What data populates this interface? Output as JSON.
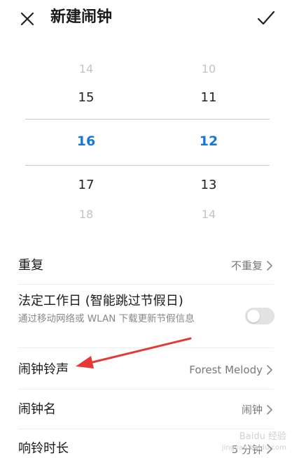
{
  "header": {
    "title": "新建闹钟"
  },
  "time_picker": {
    "hour": {
      "above_far": "14",
      "above": "15",
      "selected": "16",
      "below": "17",
      "below_far": "18"
    },
    "minute": {
      "above_far": "10",
      "above": "11",
      "selected": "12",
      "below": "13",
      "below_far": "14"
    },
    "accent_color": "#1878d6"
  },
  "settings": {
    "repeat": {
      "label": "重复",
      "value": "不重复"
    },
    "workday": {
      "label": "法定工作日 (智能跳过节假日)",
      "description": "通过移动网络或 WLAN 下载更新节假信息",
      "toggle_on": false
    },
    "ringtone": {
      "label": "闹钟铃声",
      "value": "Forest Melody"
    },
    "name": {
      "label": "闹钟名",
      "value": "闹钟"
    },
    "duration": {
      "label": "响铃时长",
      "value": "5 分钟"
    }
  },
  "watermark": {
    "text": "Baidu 经验",
    "subtext": "jingyan.baidu.com"
  },
  "annotation_arrow_color": "#e53935"
}
